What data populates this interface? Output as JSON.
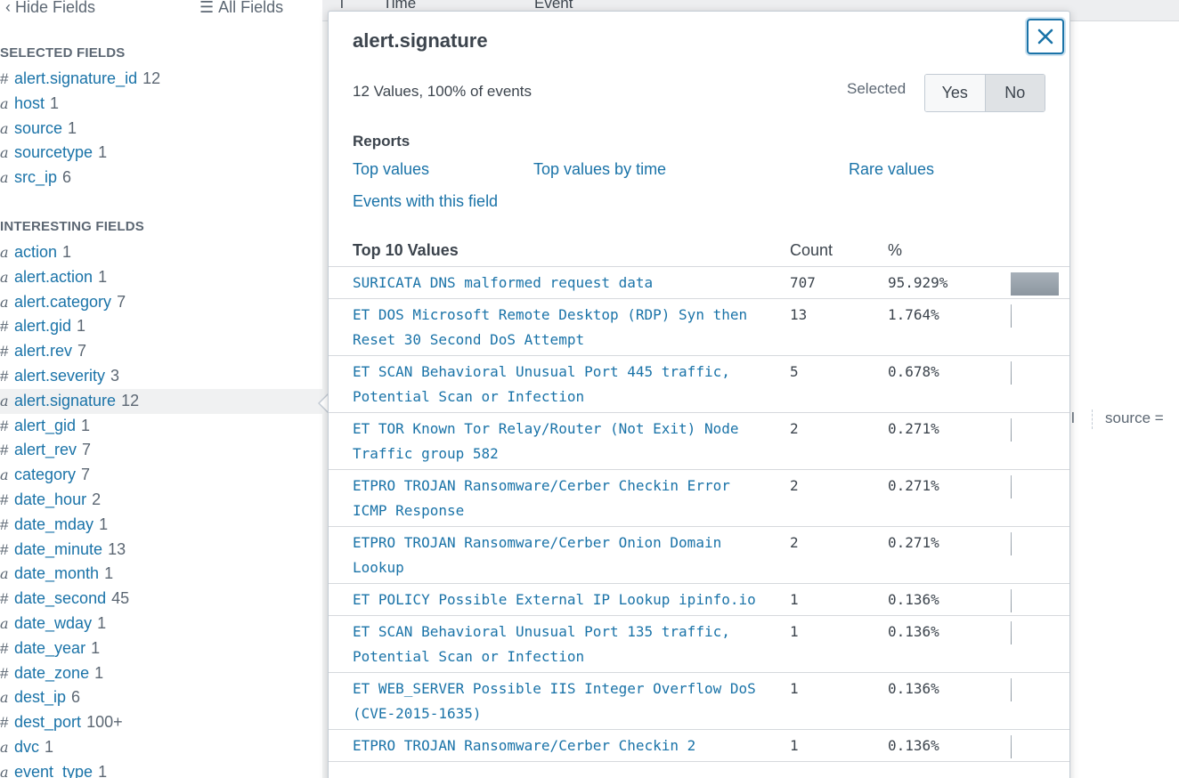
{
  "toolbar": {
    "hide_fields_label": "Hide Fields",
    "all_fields_label": "All Fields"
  },
  "selected_fields": {
    "heading": "SELECTED FIELDS",
    "items": [
      {
        "type": "#",
        "name": "alert.signature_id",
        "count": "12"
      },
      {
        "type": "a",
        "name": "host",
        "count": "1"
      },
      {
        "type": "a",
        "name": "source",
        "count": "1"
      },
      {
        "type": "a",
        "name": "sourcetype",
        "count": "1"
      },
      {
        "type": "a",
        "name": "src_ip",
        "count": "6"
      }
    ]
  },
  "interesting_fields": {
    "heading": "INTERESTING FIELDS",
    "items": [
      {
        "type": "a",
        "name": "action",
        "count": "1"
      },
      {
        "type": "a",
        "name": "alert.action",
        "count": "1"
      },
      {
        "type": "a",
        "name": "alert.category",
        "count": "7"
      },
      {
        "type": "#",
        "name": "alert.gid",
        "count": "1"
      },
      {
        "type": "#",
        "name": "alert.rev",
        "count": "7"
      },
      {
        "type": "#",
        "name": "alert.severity",
        "count": "3"
      },
      {
        "type": "a",
        "name": "alert.signature",
        "count": "12"
      },
      {
        "type": "#",
        "name": "alert_gid",
        "count": "1"
      },
      {
        "type": "#",
        "name": "alert_rev",
        "count": "7"
      },
      {
        "type": "a",
        "name": "category",
        "count": "7"
      },
      {
        "type": "#",
        "name": "date_hour",
        "count": "2"
      },
      {
        "type": "#",
        "name": "date_mday",
        "count": "1"
      },
      {
        "type": "#",
        "name": "date_minute",
        "count": "13"
      },
      {
        "type": "a",
        "name": "date_month",
        "count": "1"
      },
      {
        "type": "#",
        "name": "date_second",
        "count": "45"
      },
      {
        "type": "a",
        "name": "date_wday",
        "count": "1"
      },
      {
        "type": "#",
        "name": "date_year",
        "count": "1"
      },
      {
        "type": "#",
        "name": "date_zone",
        "count": "1"
      },
      {
        "type": "a",
        "name": "dest_ip",
        "count": "6"
      },
      {
        "type": "#",
        "name": "dest_port",
        "count": "100+"
      },
      {
        "type": "a",
        "name": "dvc",
        "count": "1"
      },
      {
        "type": "a",
        "name": "event_type",
        "count": "1"
      }
    ]
  },
  "events_header": {
    "col_i": "i",
    "col_time": "Time",
    "col_event": "Event"
  },
  "background_event": {
    "separator_fragment": "l",
    "source_label": "source ="
  },
  "popover": {
    "title": "alert.signature",
    "summary": "12 Values, 100% of events",
    "selected_label": "Selected",
    "toggle_yes": "Yes",
    "toggle_no": "No",
    "reports_heading": "Reports",
    "report_links": {
      "top_values": "Top values",
      "top_values_by_time": "Top values by time",
      "rare_values": "Rare values",
      "events_with_field": "Events with this field"
    },
    "table_headers": {
      "values": "Top 10 Values",
      "count": "Count",
      "percent": "%"
    },
    "rows": [
      {
        "value": "SURICATA DNS malformed request data",
        "count": "707",
        "percent": "95.929%",
        "fraction": 0.95929
      },
      {
        "value": "ET DOS Microsoft Remote Desktop (RDP) Syn then Reset 30 Second DoS Attempt",
        "count": "13",
        "percent": "1.764%",
        "fraction": 0.01764
      },
      {
        "value": "ET SCAN Behavioral Unusual Port 445 traffic, Potential Scan or Infection",
        "count": "5",
        "percent": "0.678%",
        "fraction": 0.00678
      },
      {
        "value": "ET TOR Known Tor Relay/Router (Not Exit) Node Traffic group 582",
        "count": "2",
        "percent": "0.271%",
        "fraction": 0.00271
      },
      {
        "value": "ETPRO TROJAN Ransomware/Cerber Checkin Error ICMP Response",
        "count": "2",
        "percent": "0.271%",
        "fraction": 0.00271
      },
      {
        "value": "ETPRO TROJAN Ransomware/Cerber Onion Domain Lookup",
        "count": "2",
        "percent": "0.271%",
        "fraction": 0.00271
      },
      {
        "value": "ET POLICY Possible External IP Lookup ipinfo.io",
        "count": "1",
        "percent": "0.136%",
        "fraction": 0.00136
      },
      {
        "value": "ET SCAN Behavioral Unusual Port 135 traffic, Potential Scan or Infection",
        "count": "1",
        "percent": "0.136%",
        "fraction": 0.00136
      },
      {
        "value": "ET WEB_SERVER Possible IIS Integer Overflow DoS (CVE-2015-1635)",
        "count": "1",
        "percent": "0.136%",
        "fraction": 0.00136
      },
      {
        "value": "ETPRO TROJAN Ransomware/Cerber Checkin 2",
        "count": "1",
        "percent": "0.136%",
        "fraction": 0.00136
      }
    ]
  },
  "colors": {
    "link": "#1a73a8",
    "text": "#3c444d",
    "muted": "#5c6773",
    "bar": "#9aa3ad"
  }
}
